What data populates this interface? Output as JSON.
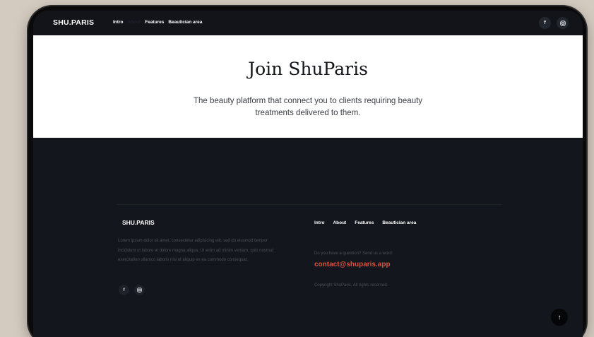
{
  "nav": {
    "brand": "SHU.PARIS",
    "links": [
      {
        "label": "Intro",
        "active": false
      },
      {
        "label": "About",
        "active": true
      },
      {
        "label": "Features",
        "active": false
      },
      {
        "label": "Beautician area",
        "active": false
      }
    ],
    "social": [
      {
        "icon": "facebook-icon",
        "glyph": "f"
      },
      {
        "icon": "instagram-icon",
        "glyph": ""
      }
    ]
  },
  "hero": {
    "title": "Join ShuParis",
    "subtitle": "The beauty platform that connect you to clients requiring beauty treatments delivered to them."
  },
  "footer": {
    "brand": "SHU.PARIS",
    "description": "Lorem ipsum dolor sit amet, consectetur adipisicing elit, sed do eiusmod tempor incididunt ut labore et dolore magna aliqua. Ut enim ad minim veniam, quis nostrud exercitation ullamco laboris nisi ut aliquip ex ea commodo consequat.",
    "social": [
      {
        "icon": "facebook-icon",
        "glyph": "f"
      },
      {
        "icon": "instagram-icon",
        "glyph": ""
      }
    ],
    "links": [
      "Intro",
      "About",
      "Features",
      "Beautician area"
    ],
    "question": "Do you have a question? Send us a word:",
    "email": "contact@shuparis.app",
    "copyright": "Copyright ShuParis. All rights reserved."
  },
  "scroll_top": {
    "icon": "arrow-up-icon",
    "glyph": "↑"
  },
  "colors": {
    "accent": "#e14d3e",
    "background": "#13161c",
    "hero_background": "#ffffff"
  }
}
